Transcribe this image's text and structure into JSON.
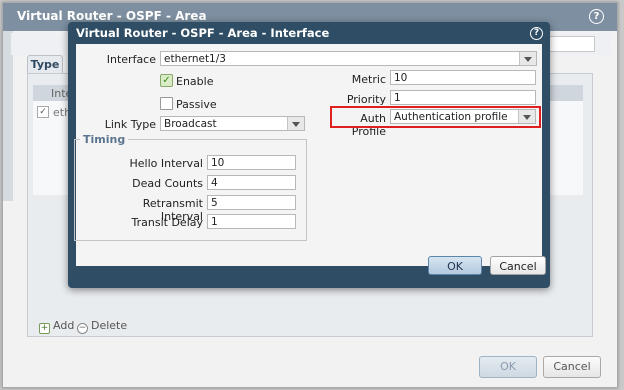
{
  "outer": {
    "title": "Virtual Router - OSPF - Area",
    "tab_label": "Type",
    "grid_header": "Inter",
    "row_text": "ethe",
    "add_label": "Add",
    "delete_label": "Delete",
    "ok_label": "OK",
    "cancel_label": "Cancel"
  },
  "modal": {
    "title": "Virtual Router - OSPF - Area - Interface",
    "interface": {
      "label": "Interface",
      "value": "ethernet1/3"
    },
    "enable": {
      "label": "Enable",
      "checked": true
    },
    "passive": {
      "label": "Passive",
      "checked": false
    },
    "link_type": {
      "label": "Link Type",
      "value": "Broadcast"
    },
    "metric": {
      "label": "Metric",
      "value": "10"
    },
    "priority": {
      "label": "Priority",
      "value": "1"
    },
    "auth_profile": {
      "label": "Auth Profile",
      "value": "Authentication profile"
    },
    "timing": {
      "legend": "Timing",
      "hello_interval": {
        "label": "Hello Interval",
        "value": "10"
      },
      "dead_counts": {
        "label": "Dead Counts",
        "value": "4"
      },
      "retransmit_interval": {
        "label": "Retransmit Interval",
        "value": "5"
      },
      "transit_delay": {
        "label": "Transit Delay",
        "value": "1"
      }
    },
    "ok_label": "OK",
    "cancel_label": "Cancel"
  },
  "icons": {
    "help": "help-circle-icon",
    "dropdown": "chevron-down-icon",
    "add": "plus-icon",
    "delete": "minus-circle-icon",
    "checkbox": "check-icon"
  },
  "colors": {
    "modal_frame": "#2f4e66",
    "outer_title": "#7d8fa0",
    "highlight": "#e0201e",
    "timing_legend": "#5b7590"
  }
}
